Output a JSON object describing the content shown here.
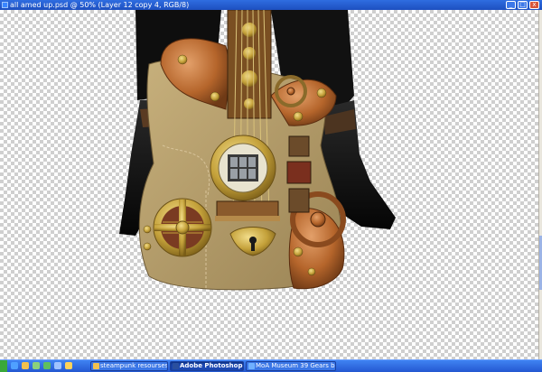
{
  "window": {
    "title": "all amed up.psd @ 50% (Layer 12 copy 4, RGB/8)",
    "controls": {
      "minimize": "_",
      "maximize": "□",
      "close": "x"
    }
  },
  "colors": {
    "checker_light": "#ffffff",
    "checker_dark": "#cfcfcf",
    "guitar_body": "#b19a6a",
    "copper": "#b5652b",
    "brass": "#c4a13a",
    "titlebar": "#1d4fbf",
    "taskbar": "#2458d1"
  },
  "taskbar": {
    "quick_launch_icons": [
      "ie-icon",
      "folder-icon",
      "media-icon",
      "messenger-icon",
      "desktop-icon",
      "winamp-icon"
    ],
    "tasks": [
      {
        "label": "steampunk resourses an...",
        "icon": "folder-icon",
        "active": false
      },
      {
        "label": "Adobe Photoshop",
        "icon": "photoshop-icon",
        "active": true
      },
      {
        "label": "MoA Museum 39 Gears b...",
        "icon": "browser-icon",
        "active": false
      }
    ]
  }
}
